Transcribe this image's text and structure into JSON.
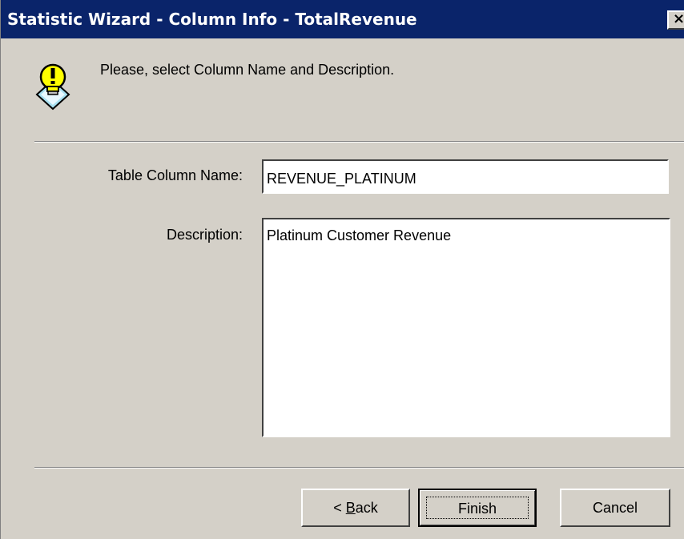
{
  "window": {
    "title": "Statistic Wizard - Column Info - TotalRevenue",
    "close_glyph": "×"
  },
  "hint": {
    "icon": "lightbulb-exclamation-icon",
    "text": "Please, select Column Name and Description."
  },
  "form": {
    "column_name_label": "Table Column Name:",
    "column_name_value": "REVENUE_PLATINUM",
    "description_label": "Description:",
    "description_value": "Platinum Customer Revenue"
  },
  "buttons": {
    "back_prefix": "< ",
    "back_key": "B",
    "back_rest": "ack",
    "finish_label": "Finish",
    "cancel_label": "Cancel"
  },
  "colors": {
    "titlebar": "#0a246a",
    "face": "#d4d0c8",
    "bulb": "#ffff00"
  }
}
